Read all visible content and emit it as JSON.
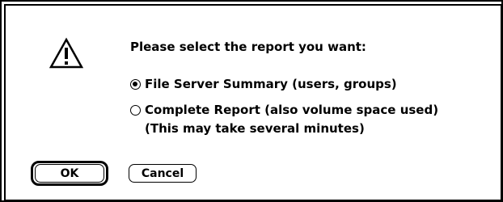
{
  "dialog": {
    "icon": "caution-icon",
    "prompt": "Please select the report you want:",
    "options": [
      {
        "label": "File Server Summary (users, groups)",
        "selected": true
      },
      {
        "label": "Complete Report (also volume space used)",
        "selected": false
      }
    ],
    "note": "(This may take several minutes)",
    "buttons": {
      "ok_label": "OK",
      "cancel_label": "Cancel",
      "default": "ok"
    }
  }
}
